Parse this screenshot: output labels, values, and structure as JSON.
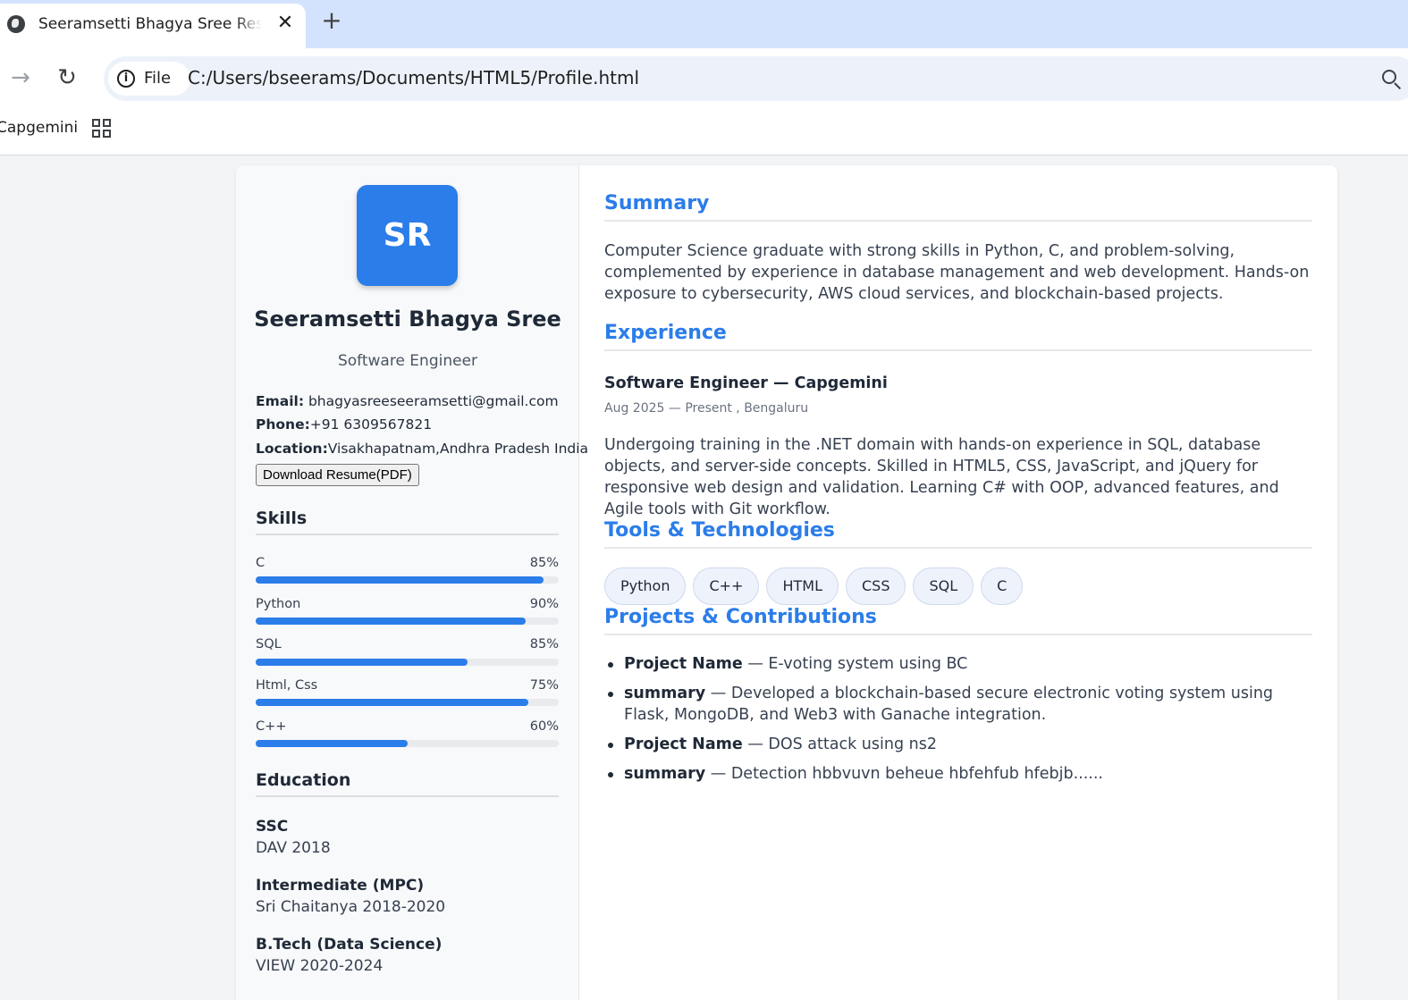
{
  "browser": {
    "tab_title": "Seeramsetti Bhagya Sree Resume",
    "tab_close": "✕",
    "new_tab": "+",
    "forward_glyph": "→",
    "reload_glyph": "↻",
    "info_glyph": "i",
    "chip_label": "File",
    "url": "C:/Users/bseerams/Documents/HTML5/Profile.html",
    "bookmark": "Capgemini"
  },
  "profile": {
    "initials": "SR",
    "name": "Seeramsetti Bhagya Sree",
    "role": "Software Engineer",
    "email_label": "Email:",
    "email": "bhagyasreeseeramsetti@gmail.com",
    "phone_label": "Phone:",
    "phone": "+91 6309567821",
    "location_label": "Location:",
    "location": "Visakhapatnam,Andhra Pradesh India",
    "download_label": "Download Resume(PDF)"
  },
  "skills": {
    "heading": "Skills",
    "items": [
      {
        "name": "C",
        "pct": "85%",
        "fill": 0.95
      },
      {
        "name": "Python",
        "pct": "90%",
        "fill": 0.89
      },
      {
        "name": "SQL",
        "pct": "85%",
        "fill": 0.7
      },
      {
        "name": "Html, Css",
        "pct": "75%",
        "fill": 0.9
      },
      {
        "name": "C++",
        "pct": "60%",
        "fill": 0.5
      }
    ]
  },
  "education": {
    "heading": "Education",
    "items": [
      {
        "title": "SSC",
        "sub": "DAV 2018"
      },
      {
        "title": "Intermediate (MPC)",
        "sub": "Sri Chaitanya 2018-2020"
      },
      {
        "title": "B.Tech (Data Science)",
        "sub": "VIEW 2020-2024"
      }
    ]
  },
  "summary": {
    "heading": "Summary",
    "text": "Computer Science graduate with strong skills in Python, C, and problem-solving, complemented by experience in database management and web development. Hands-on exposure to cybersecurity, AWS cloud services, and blockchain-based projects."
  },
  "experience": {
    "heading": "Experience",
    "job_title": "Software Engineer — Capgemini",
    "meta": "Aug 2025 — Present , Bengaluru",
    "text": "Undergoing training in the .NET domain with hands-on experience in SQL, database objects, and server-side concepts. Skilled in HTML5, CSS, JavaScript, and jQuery for responsive web design and validation. Learning C# with OOP, advanced features, and Agile tools with Git workflow."
  },
  "tools": {
    "heading": "Tools & Technologies",
    "items": [
      "Python",
      "C++",
      "HTML",
      "CSS",
      "SQL",
      "C"
    ]
  },
  "projects": {
    "heading": "Projects & Contributions",
    "items": [
      {
        "label": "Project Name",
        "text": " — E-voting system using BC"
      },
      {
        "label": "summary",
        "text": " — Developed a blockchain-based secure electronic voting system using Flask, MongoDB, and Web3 with Ganache integration."
      },
      {
        "label": "Project Name",
        "text": " — DOS attack using ns2"
      },
      {
        "label": "summary",
        "text": " — Detection hbbvuvn beheue hbfehfub hfebjb......"
      }
    ]
  },
  "colors": {
    "accent": "#2b7de9",
    "chrome_tabstrip": "#d3e3fd",
    "omnibox": "#edf2fa"
  },
  "icons": [
    "globe-icon",
    "close-icon",
    "plus-icon",
    "forward-arrow-icon",
    "reload-icon",
    "info-icon",
    "zoom-icon",
    "apps-grid-icon"
  ]
}
